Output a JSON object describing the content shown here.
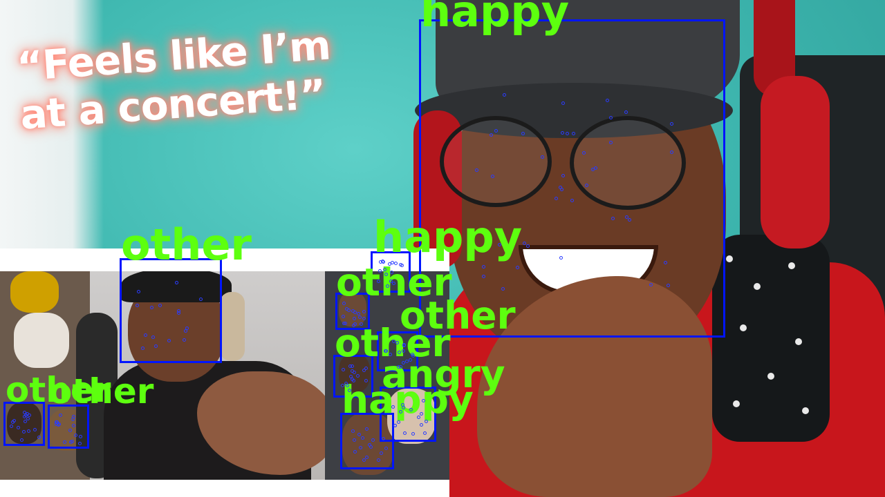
{
  "caption": {
    "line1": "“Feels like I’m",
    "line2": "at a concert!”"
  },
  "detections": [
    {
      "label": "happy"
    },
    {
      "label": "other"
    },
    {
      "label": "happy"
    },
    {
      "label": "other"
    },
    {
      "label": "other"
    },
    {
      "label": "other"
    },
    {
      "label": "angry"
    },
    {
      "label": "happy"
    },
    {
      "label": "other"
    },
    {
      "label": "other"
    }
  ],
  "colors": {
    "box": "#0015ff",
    "label": "#5dff0f",
    "landmark": "#2a3cff"
  }
}
